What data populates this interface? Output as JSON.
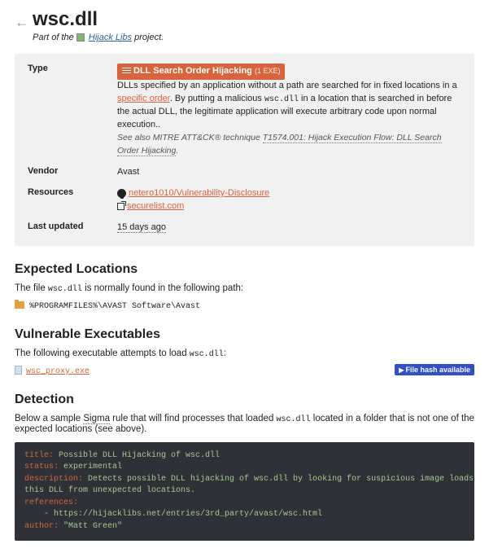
{
  "header": {
    "title": "wsc.dll",
    "subtitle_prefix": "Part of the ",
    "project_link": "Hijack Libs",
    "subtitle_suffix": " project."
  },
  "info": {
    "type_label": "Type",
    "type_badge": "DLL Search Order Hijacking",
    "type_badge_sub": "(1 EXE)",
    "type_desc_1": "DLLs specified by an application without a path are searched for in fixed locations in a ",
    "type_desc_link": "specific order",
    "type_desc_2": ". By putting a malicious ",
    "type_desc_code": "wsc.dll",
    "type_desc_3": " in a location that is searched in before the actual DLL, the legitimate application will execute arbitrary code upon normal execution..",
    "seealso_prefix": "See also MITRE ATT&CK® technique ",
    "seealso_link": "T1574.001: Hijack Execution Flow: DLL Search Order Hijacking",
    "seealso_suffix": ".",
    "vendor_label": "Vendor",
    "vendor_value": "Avast",
    "resources_label": "Resources",
    "resource1": "netero1010/Vulnerability-Disclosure",
    "resource2": "securelist.com",
    "lastupdated_label": "Last updated",
    "lastupdated_value": "15 days ago"
  },
  "expected": {
    "heading": "Expected Locations",
    "intro_1": "The file ",
    "intro_code": "wsc.dll",
    "intro_2": " is normally found in the following path:",
    "path": "%PROGRAMFILES%\\AVAST Software\\Avast"
  },
  "vuln": {
    "heading": "Vulnerable Executables",
    "intro_1": "The following executable attempts to load ",
    "intro_code": "wsc.dll",
    "intro_2": ":",
    "exe": "wsc_proxy.exe",
    "hash_badge": "File hash available"
  },
  "detect": {
    "heading": "Detection",
    "intro_1": "Below a sample ",
    "sigma": "Sigma",
    "intro_2": " rule that will find processes that loaded ",
    "intro_code": "wsc.dll",
    "intro_3": " located in a folder that is not one of the expected locations (see above).",
    "yaml": {
      "k_title": "title:",
      "v_title": " Possible DLL Hijacking of wsc.dll",
      "k_status": "status:",
      "v_status": " experimental",
      "k_desc": "description:",
      "v_desc": " Detects possible DLL hijacking of wsc.dll by looking for suspicious image loads, loading",
      "v_desc2": "this DLL from unexpected locations.",
      "k_refs": "references:",
      "v_ref1": "    - https://hijacklibs.net/entries/3rd_party/avast/wsc.html",
      "k_author": "author:",
      "v_author": " \"Matt Green\""
    }
  }
}
